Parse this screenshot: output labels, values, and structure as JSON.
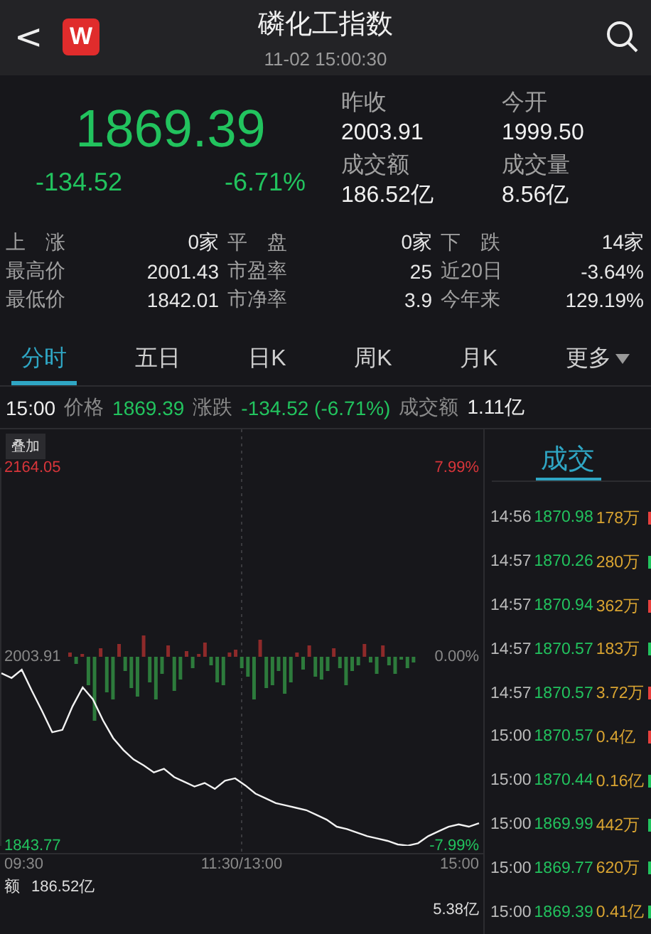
{
  "header": {
    "back": "<",
    "logo": "W",
    "title": "磷化工指数",
    "time": "11-02 15:00:30"
  },
  "quote": {
    "price": "1869.39",
    "change": "-134.52",
    "percent": "-6.71%",
    "rising": false
  },
  "summary": [
    {
      "label": "昨收",
      "value": "2003.91"
    },
    {
      "label": "今开",
      "value": "1999.50"
    },
    {
      "label": "成交额",
      "value": "186.52亿"
    },
    {
      "label": "成交量",
      "value": "8.56亿"
    }
  ],
  "stats": [
    [
      {
        "label": "上　涨",
        "value": "0家"
      },
      {
        "label": "平　盘",
        "value": "0家"
      },
      {
        "label": "下　跌",
        "value": "14家"
      }
    ],
    [
      {
        "label": "最高价",
        "value": "2001.43"
      },
      {
        "label": "市盈率",
        "value": "25"
      },
      {
        "label": "近20日",
        "value": "-3.64%"
      }
    ],
    [
      {
        "label": "最低价",
        "value": "1842.01"
      },
      {
        "label": "市净率",
        "value": "3.9"
      },
      {
        "label": "今年来",
        "value": "129.19%"
      }
    ]
  ],
  "tabs": [
    {
      "label": "分时",
      "selected": true
    },
    {
      "label": "五日",
      "selected": false
    },
    {
      "label": "日K",
      "selected": false
    },
    {
      "label": "周K",
      "selected": false
    },
    {
      "label": "月K",
      "selected": false
    },
    {
      "label": "更多",
      "selected": false,
      "dropdown": true
    }
  ],
  "info_line": {
    "time": "15:00",
    "price_label": "价格",
    "price": "1869.39",
    "change_label": "涨跌",
    "change": "-134.52 (-6.71%)",
    "amount_label": "成交额",
    "amount": "1.11亿"
  },
  "chart": {
    "overlay_button": "叠加",
    "top_percent": "7.99%",
    "base_percent": "0.00%",
    "bottom_percent": "-7.99%",
    "time_labels": [
      "09:30",
      "11:30/13:00",
      "15:00"
    ],
    "volume_label": "额",
    "volume_total": "186.52亿",
    "volume_max": "5.38亿",
    "chart_data": {
      "type": "line",
      "ylim": [
        1843.77,
        2164.05
      ],
      "series": [
        {
          "color": "#f2f2f2",
          "values": [
            1990,
            1986,
            1993,
            1975,
            1958,
            1940,
            1942,
            1962,
            1978,
            1968,
            1950,
            1935,
            1925,
            1917,
            1912,
            1906,
            1909,
            1902,
            1898,
            1894,
            1897,
            1892,
            1899,
            1901,
            1895,
            1888,
            1884,
            1880,
            1878,
            1876,
            1874,
            1870,
            1866,
            1860,
            1858,
            1855,
            1852,
            1850,
            1848,
            1845,
            1844,
            1846,
            1852,
            1856,
            1860,
            1862,
            1860,
            1863
          ]
        }
      ],
      "yticks": [
        {
          "value": 2164.05,
          "label": "2164.05"
        },
        {
          "value": 2003.91,
          "label": "2003.91"
        },
        {
          "value": 1843.77,
          "label": "1843.77"
        }
      ]
    }
  },
  "trades": {
    "title": "成交",
    "rows": [
      {
        "time": "14:56",
        "price": "1870.98",
        "volume": "178万",
        "buy": true
      },
      {
        "time": "14:57",
        "price": "1870.26",
        "volume": "280万",
        "buy": false
      },
      {
        "time": "14:57",
        "price": "1870.94",
        "volume": "362万",
        "buy": true
      },
      {
        "time": "14:57",
        "price": "1870.57",
        "volume": "183万",
        "buy": false
      },
      {
        "time": "14:57",
        "price": "1870.57",
        "volume": "3.72万",
        "buy": true
      },
      {
        "time": "15:00",
        "price": "1870.57",
        "volume": "0.4亿",
        "buy": true
      },
      {
        "time": "15:00",
        "price": "1870.44",
        "volume": "0.16亿",
        "buy": false
      },
      {
        "time": "15:00",
        "price": "1869.99",
        "volume": "442万",
        "buy": false
      },
      {
        "time": "15:00",
        "price": "1869.77",
        "volume": "620万",
        "buy": false
      },
      {
        "time": "15:00",
        "price": "1869.39",
        "volume": "0.41亿",
        "buy": false
      }
    ]
  }
}
